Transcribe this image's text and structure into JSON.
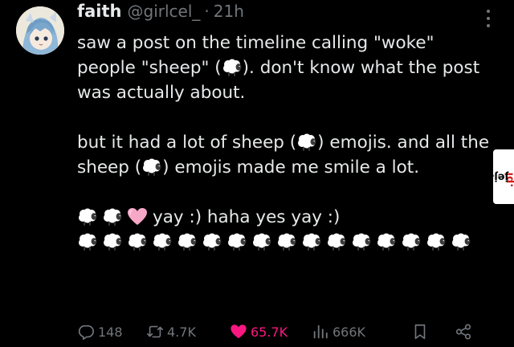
{
  "tweet": {
    "author": {
      "display_name": "faith",
      "handle": "@girlcel_",
      "separator": "·",
      "time": "21h",
      "avatar_icon": "anime-avatar"
    },
    "more_icon": "more-vertical-icon",
    "text": {
      "p1": {
        "a": "saw a post on the timeline calling \"woke\" people \"sheep\" (",
        "b": "). don't know what the post was actually about."
      },
      "p2": {
        "a": "but it had a lot of sheep (",
        "b": ") emojis. and all the sheep (",
        "c": ") emojis made me smile a lot."
      },
      "p3": {
        "text": "yay :) haha yes yay :)",
        "line1_sheep_count": 2,
        "line2_sheep_count": 16
      },
      "emoji": [
        "sheep-emoji",
        "pink-heart-emoji"
      ]
    },
    "actions": {
      "replies": "148",
      "reposts": "4.7K",
      "likes": "65.7K",
      "views": "666K",
      "like_color": "#f91880",
      "icons": [
        "reply-icon",
        "repost-icon",
        "heart-icon",
        "views-icon",
        "bookmark-icon",
        "share-icon"
      ]
    }
  },
  "watermark": {
    "text_main": "jeja",
    "text_accent": ".pl"
  },
  "colors": {
    "background": "#000000",
    "text": "#e7e9ea",
    "muted": "#71767b",
    "like": "#f91880"
  }
}
